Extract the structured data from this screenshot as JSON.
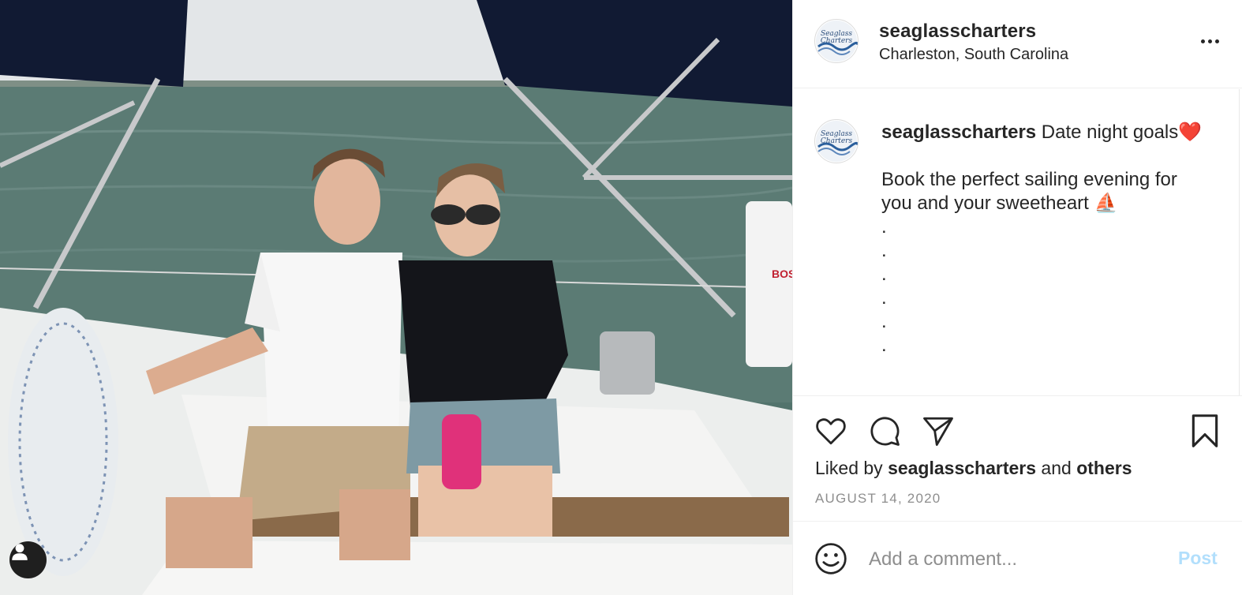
{
  "post": {
    "username": "seaglasscharters",
    "location": "Charleston, South Carolina",
    "avatar_text": [
      "Seaglass",
      "Charters"
    ],
    "caption": {
      "username": "seaglasscharters",
      "text": " Date night goals❤️\n\nBook the perfect sailing evening for you and your sweetheart ⛵\n.\n.\n.\n.\n.\n."
    },
    "likes": {
      "prefix": "Liked by ",
      "user": "seaglasscharters",
      "middle": " and ",
      "others": "others"
    },
    "date": "AUGUST 14, 2020"
  },
  "photo": {
    "boat_text": "BOS"
  },
  "comment": {
    "placeholder": "Add a comment...",
    "post_label": "Post"
  },
  "icons": {
    "like": "heart-icon",
    "comment": "comment-icon",
    "share": "paper-plane-icon",
    "save": "bookmark-icon",
    "more": "more-icon",
    "emoji": "smiley-icon",
    "tag": "user-icon"
  },
  "colors": {
    "text": "#262626",
    "secondary": "#8e8e8e",
    "post_disabled": "#b2dffc",
    "border": "#efefef"
  }
}
